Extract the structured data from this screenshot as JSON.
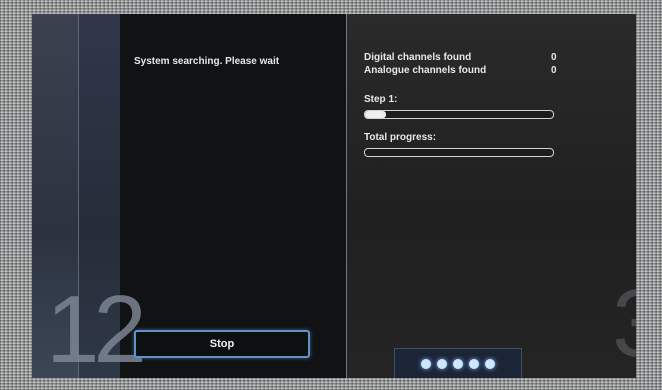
{
  "screen": {
    "left_number": "12",
    "right_number": "3",
    "status": "System searching. Please wait",
    "digital_label": "Digital channels found",
    "digital_count": "0",
    "analogue_label": "Analogue channels found",
    "analogue_count": "0",
    "step_label": "Step 1:",
    "step_progress": 0.11,
    "total_label": "Total progress:",
    "total_progress": 0.0,
    "stop_label": "Stop",
    "page_dots": 5
  }
}
